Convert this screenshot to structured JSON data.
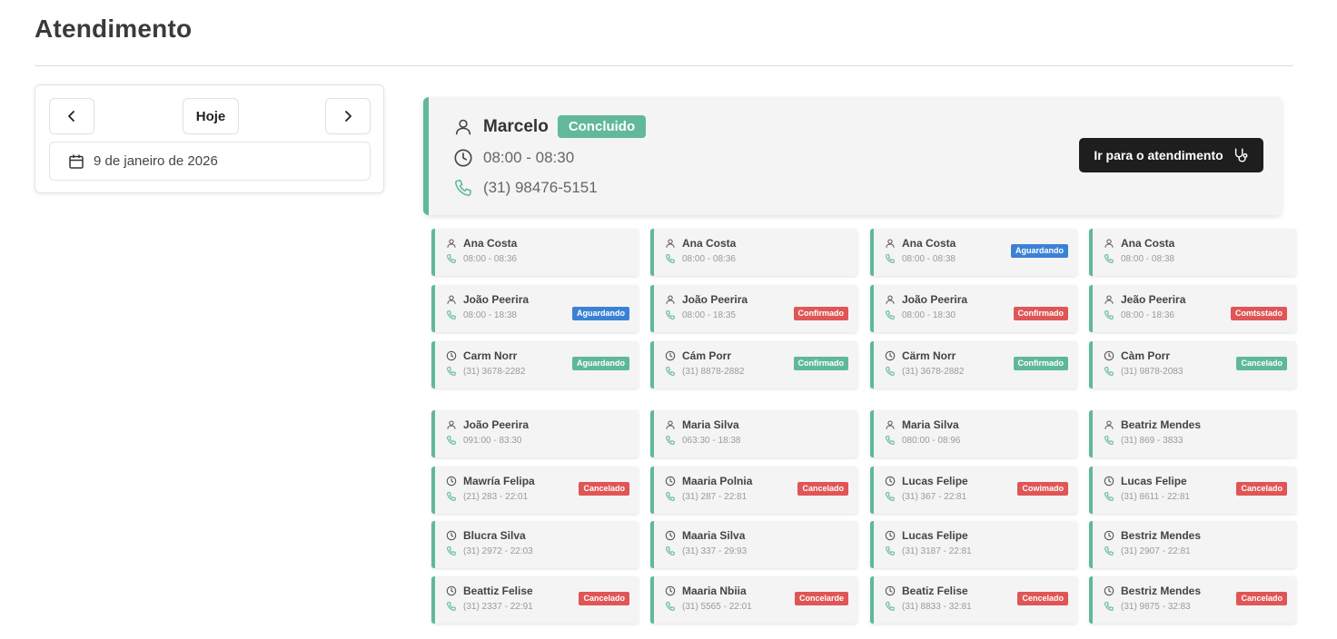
{
  "page": {
    "title": "Atendimento"
  },
  "date_nav": {
    "today_label": "Hoje",
    "date_text": "9 de janeiro de 2026"
  },
  "featured": {
    "name": "Marcelo",
    "status": "Concluido",
    "time": "08:00 - 08:30",
    "phone": "(31) 98476-5151",
    "action_label": "Ir para o atendimento"
  },
  "colors": {
    "accent": "#5fb89a",
    "aguardando": "#3b82d6",
    "confirmado_red": "#e05555",
    "confirmado_green": "#5fb89a",
    "cancelado": "#e05555"
  },
  "cards": [
    {
      "name": "Ana Costa",
      "sub": "08:00 - 08:36",
      "icon": "user",
      "badge": "",
      "badge_color": ""
    },
    {
      "name": "Ana Costa",
      "sub": "08:00 - 08:36",
      "icon": "user",
      "badge": "",
      "badge_color": ""
    },
    {
      "name": "Ana Costa",
      "sub": "08:00 - 08:38",
      "icon": "user",
      "badge": "Aguardando",
      "badge_color": "#3b82d6",
      "badge_top": true
    },
    {
      "name": "Ana Costa",
      "sub": "08:00 - 08:38",
      "icon": "user",
      "badge": "",
      "badge_color": ""
    },
    {
      "name": "João Peerira",
      "sub": "08:00 - 18:38",
      "icon": "user",
      "badge": "Aguardando",
      "badge_color": "#3b82d6"
    },
    {
      "name": "João Peerira",
      "sub": "08:00 - 18:35",
      "icon": "user",
      "badge": "Confirmado",
      "badge_color": "#e05555"
    },
    {
      "name": "João Peerira",
      "sub": "08:00 - 18:30",
      "icon": "user",
      "badge": "Confirmado",
      "badge_color": "#e05555"
    },
    {
      "name": "Jeão Peerira",
      "sub": "08:00 - 18:36",
      "icon": "user",
      "badge": "Comtsstado",
      "badge_color": "#e05555"
    },
    {
      "name": "Carm Norr",
      "sub": "(31) 3678-2282",
      "icon": "clock",
      "badge": "Aguardando",
      "badge_color": "#5fb89a",
      "badge_top": true
    },
    {
      "name": "Cám Porr",
      "sub": "(31) 8878-2882",
      "icon": "clock",
      "badge": "Confirmado",
      "badge_color": "#5fb89a",
      "badge_top": true
    },
    {
      "name": "Cärm Norr",
      "sub": "(31) 3678-2882",
      "icon": "clock",
      "badge": "Confirmado",
      "badge_color": "#5fb89a",
      "badge_top": true
    },
    {
      "name": "Càm Porr",
      "sub": "(31) 9878-2083",
      "icon": "clock",
      "badge": "Cancelado",
      "badge_color": "#5fb89a",
      "badge_top": true
    },
    {
      "name": "João Peerira",
      "sub": "091:00 - 83:30",
      "icon": "user",
      "badge": "",
      "badge_color": ""
    },
    {
      "name": "Maria Silva",
      "sub": "063:30 - 18:38",
      "icon": "user",
      "badge": "",
      "badge_color": ""
    },
    {
      "name": "Maria Silva",
      "sub": "080:00 - 08:96",
      "icon": "user",
      "badge": "",
      "badge_color": ""
    },
    {
      "name": "Beatriz Mendes",
      "sub": "(31) 869 - 3833",
      "icon": "user",
      "badge": "",
      "badge_color": ""
    },
    {
      "name": "Mawría Felipa",
      "sub": "(21) 283 - 22:01",
      "icon": "clock",
      "badge": "Cancelado",
      "badge_color": "#e05555",
      "badge_top": true
    },
    {
      "name": "Maaria Polnia",
      "sub": "(31) 287 - 22:81",
      "icon": "clock",
      "badge": "Cancelado",
      "badge_color": "#e05555",
      "badge_top": true
    },
    {
      "name": "Lucas Felipe",
      "sub": "(31) 367 - 22:81",
      "icon": "clock",
      "badge": "Cowimado",
      "badge_color": "#e05555",
      "badge_top": true
    },
    {
      "name": "Lucas Felipe",
      "sub": "(31) 8611 - 22:81",
      "icon": "clock",
      "badge": "Cancelado",
      "badge_color": "#e05555",
      "badge_top": true
    },
    {
      "name": "Blucra Silva",
      "sub": "(31) 2972 - 22:03",
      "icon": "clock",
      "badge": "",
      "badge_color": ""
    },
    {
      "name": "Maaria Silva",
      "sub": "(31) 337 - 29:93",
      "icon": "clock",
      "badge": "",
      "badge_color": ""
    },
    {
      "name": "Lucas Felipe",
      "sub": "(31) 3187 - 22:81",
      "icon": "clock",
      "badge": "",
      "badge_color": ""
    },
    {
      "name": "Bestriz Mendes",
      "sub": "(31) 2907 - 22:81",
      "icon": "clock",
      "badge": "",
      "badge_color": ""
    },
    {
      "name": "Beattiz Felise",
      "sub": "(31) 2337 - 22:91",
      "icon": "clock",
      "badge": "Cancelado",
      "badge_color": "#e05555",
      "badge_top": true
    },
    {
      "name": "Maaria Nbiia",
      "sub": "(31) 5565 - 22:01",
      "icon": "clock",
      "badge": "Concelarde",
      "badge_color": "#e05555",
      "badge_top": true
    },
    {
      "name": "Beatiz Felise",
      "sub": "(31) 8833 - 32:81",
      "icon": "clock",
      "badge": "Cencelado",
      "badge_color": "#e05555",
      "badge_top": true
    },
    {
      "name": "Bestriz Mendes",
      "sub": "(31) 9875 - 32:83",
      "icon": "clock",
      "badge": "Cancelado",
      "badge_color": "#e05555",
      "badge_top": true
    }
  ]
}
